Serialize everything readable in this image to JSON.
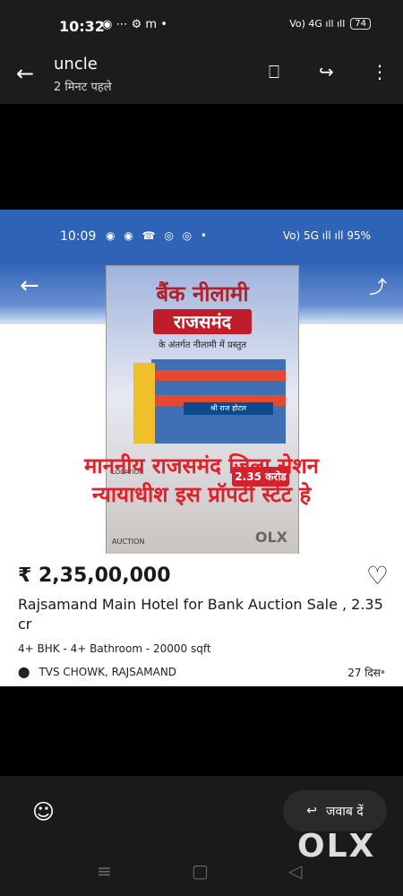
{
  "status_bar": {
    "time": "10:32",
    "icons": "◉ ⋯ ⚙ m •",
    "network": "Vo) 4G ıll ıll",
    "battery": "74"
  },
  "app_bar": {
    "title": "uncle",
    "subtitle": "2 मिनट पहले",
    "back_icon": "←",
    "bookmark_icon": "⎕",
    "forward_icon": "↪",
    "more_icon": "⋮"
  },
  "shared_screenshot": {
    "status_time": "10:09",
    "status_icons": "◉ ◉ ☎ ◎ ◎ •",
    "status_right": "Vo) 5G ıll ıll 95%",
    "poster": {
      "title": "बैंक नीलामी",
      "city": "राजसमंद",
      "subtitle": "के अंतर्गत नीलामी में प्रस्तुत",
      "hotel_sign": "श्री राज होटल",
      "location_text": "LOCATION",
      "price_tag": "2.35 करोड",
      "olx": "OLX",
      "auction": "AUCTION"
    },
    "overlay_text": [
      "माननीय राजसमंद जिला सेशन",
      "न्यायाधीश इस  प्रॉपर्टी स्टेट हे"
    ]
  },
  "listing": {
    "price": "₹ 2,35,00,000",
    "title": "Rajsamand Main Hotel for Bank Auction Sale , 2.35 cr",
    "meta": "4+ BHK - 4+ Bathroom - 20000 sqft",
    "location": "TVS CHOWK, RAJSAMAND",
    "date": "27 दिस॰"
  },
  "composer": {
    "reply_label": "जवाब दें",
    "olx_logo": "OLX"
  }
}
